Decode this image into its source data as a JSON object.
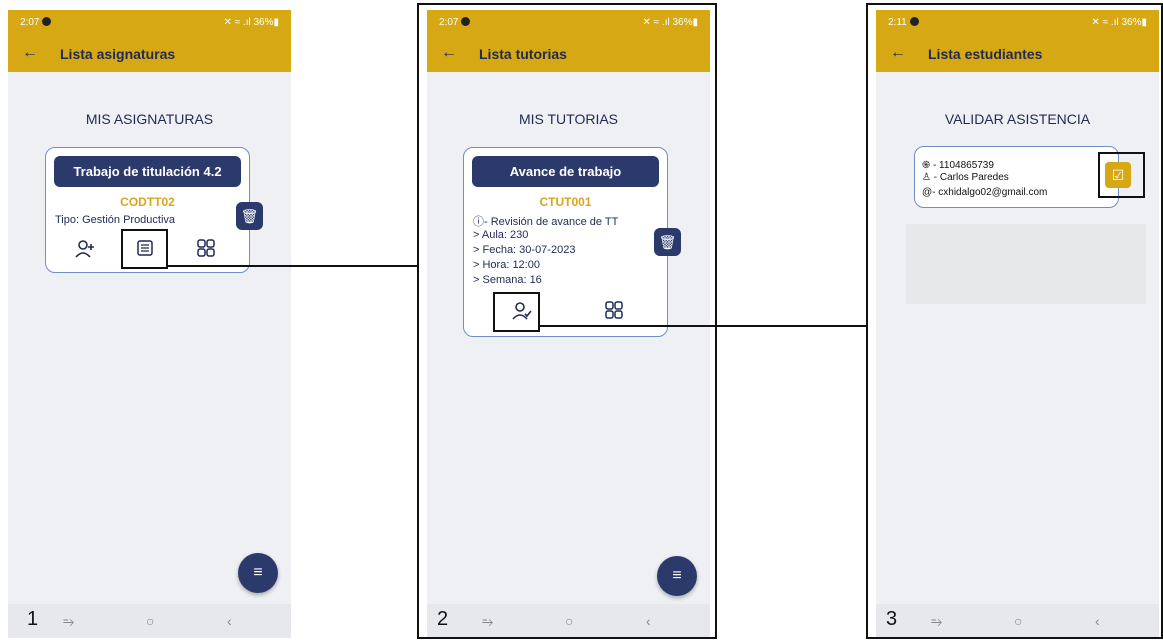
{
  "screens": [
    {
      "step": "1",
      "status": {
        "time": "2:07",
        "right": "✕ ≈ .ıl 36%▮"
      },
      "appbar": {
        "title": "Lista asignaturas"
      },
      "heading": "MIS ASIGNATURAS",
      "card": {
        "title": "Trabajo de titulación 4.2",
        "code": "CODTT02",
        "type": "Tipo: Gestión Productiva"
      }
    },
    {
      "step": "2",
      "status": {
        "time": "2:07",
        "right": "✕ ≈ .ıl 36%▮"
      },
      "appbar": {
        "title": "Lista tutorias"
      },
      "heading": "MIS TUTORIAS",
      "card": {
        "title": "Avance de trabajo",
        "code": "CTUT001",
        "info": "- Revisión de avance de TT",
        "aula": "Aula: 230",
        "fecha": "Fecha: 30-07-2023",
        "hora": "Hora: 12:00",
        "semana": "Semana: 16"
      }
    },
    {
      "step": "3",
      "status": {
        "time": "2:11",
        "right": "✕ ≈ .ıl 36%▮"
      },
      "appbar": {
        "title": "Lista estudiantes"
      },
      "heading": "VALIDAR ASISTENCIA",
      "student": {
        "id": "- 1104865739",
        "name": "- Carlos Paredes",
        "email": "- cxhidalgo02@gmail.com"
      }
    }
  ],
  "colors": {
    "accent": "#d5a814",
    "primary": "#2b3a6b",
    "background": "#eef0f3"
  }
}
